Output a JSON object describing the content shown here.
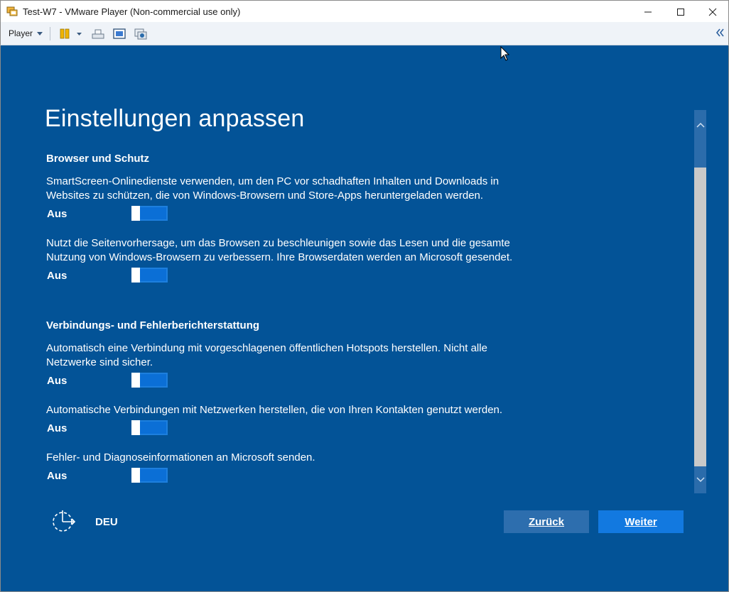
{
  "window": {
    "title": "Test-W7 - VMware Player (Non-commercial use only)",
    "icon": "vmware-player-icon"
  },
  "toolbar": {
    "player_menu_label": "Player",
    "icons": [
      "pause-icon",
      "ctrl-alt-del-icon",
      "fullscreen-icon",
      "unity-icon",
      "collapse-toolbar-icon"
    ]
  },
  "oobe": {
    "title": "Einstellungen anpassen",
    "sections": [
      {
        "heading": "Browser und Schutz",
        "settings": [
          {
            "description": "SmartScreen-Onlinedienste verwenden, um den PC vor schadhaften Inhalten und Downloads in Websites zu schützen, die von Windows-Browsern und Store-Apps heruntergeladen werden.",
            "state": "Aus"
          },
          {
            "description": "Nutzt die Seitenvorhersage, um das Browsen zu beschleunigen sowie das Lesen und die gesamte Nutzung von Windows-Browsern zu verbessern. Ihre Browserdaten werden an Microsoft gesendet.",
            "state": "Aus"
          }
        ]
      },
      {
        "heading": "Verbindungs- und Fehlerberichterstattung",
        "settings": [
          {
            "description": "Automatisch eine Verbindung mit vorgeschlagenen öffentlichen Hotspots herstellen. Nicht alle Netzwerke sind sicher.",
            "state": "Aus"
          },
          {
            "description": "Automatische Verbindungen mit Netzwerken herstellen, die von Ihren Kontakten genutzt werden.",
            "state": "Aus"
          },
          {
            "description": "Fehler- und Diagnoseinformationen an Microsoft senden.",
            "state": "Aus"
          }
        ]
      }
    ],
    "language": "DEU",
    "back_button": "Zurück",
    "next_button": "Weiter"
  },
  "colors": {
    "background": "#035397",
    "toggle_fill": "#0b6fd6",
    "next_button": "#1279e0",
    "back_button": "#2d6eae"
  }
}
